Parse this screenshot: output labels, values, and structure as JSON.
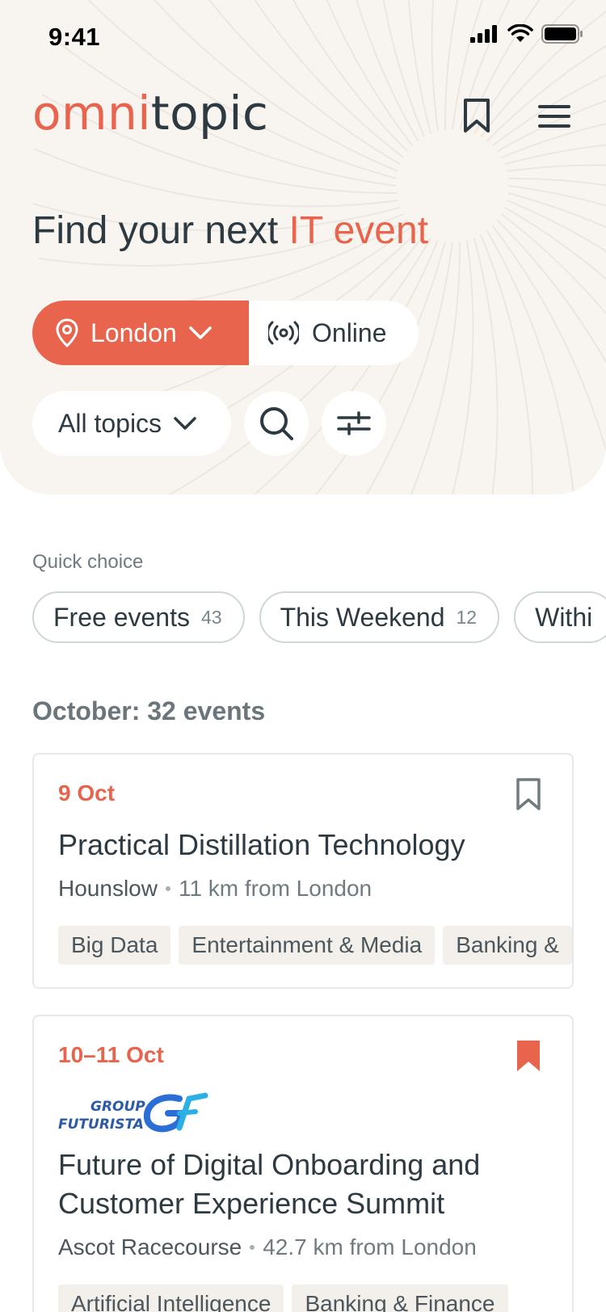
{
  "status_bar": {
    "time": "9:41"
  },
  "header": {
    "logo_part1": "omni",
    "logo_part2": "topic"
  },
  "hero": {
    "headline_plain": "Find your next ",
    "headline_accent": "IT event",
    "location_label": "London",
    "online_label": "Online",
    "topics_label": "All topics"
  },
  "quick_choice": {
    "label": "Quick choice",
    "chips": [
      {
        "label": "Free events",
        "count": "43"
      },
      {
        "label": "This Weekend",
        "count": "12"
      },
      {
        "label": "Withi",
        "count": ""
      }
    ]
  },
  "events": {
    "heading": "October: 32 events",
    "items": [
      {
        "date": "9 Oct",
        "title": "Practical Distillation Technology",
        "place": "Hounslow",
        "distance": "11 km from London",
        "bookmarked": false,
        "tags": [
          "Big Data",
          "Entertainment & Media",
          "Banking &"
        ]
      },
      {
        "date": "10–11 Oct",
        "organizer_logo_line1": "GROUP",
        "organizer_logo_line2": "FUTURISTA",
        "title_line1": "Future of Digital Onboarding and",
        "title_line2": "Customer Experience Summit",
        "place": "Ascot Racecourse",
        "distance": "42.7 km from London",
        "bookmarked": true,
        "tags": [
          "Artificial Intelligence",
          "Banking & Finance"
        ]
      }
    ]
  },
  "colors": {
    "accent": "#e8644c",
    "text_dark": "#2e3a41",
    "hero_bg": "#f8f5f1"
  }
}
